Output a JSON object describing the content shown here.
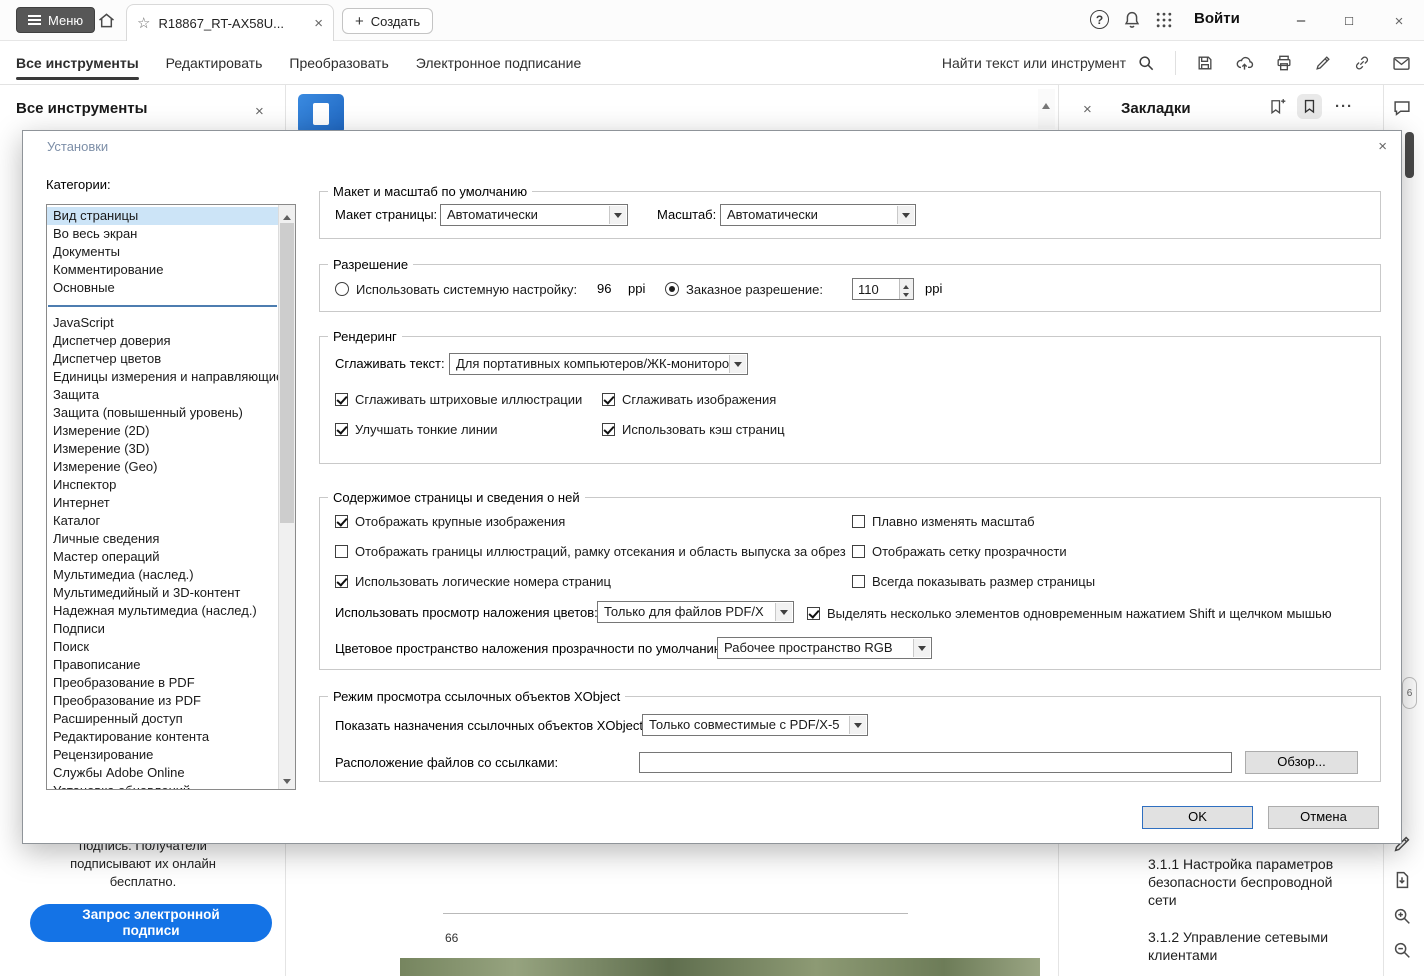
{
  "colors": {
    "accent_blue": "#1473e6",
    "selection_blue": "#cce4f7",
    "category_separator": "#4d7db0",
    "menu_button_bg": "#575757"
  },
  "topbar": {
    "menu_label": "Меню",
    "tab_title": "R18867_RT-AX58U...",
    "create_label": "Создать",
    "signin_label": "Войти"
  },
  "toolbar": {
    "tabs": [
      "Все инструменты",
      "Редактировать",
      "Преобразовать",
      "Электронное подписание"
    ],
    "active_tab": "Все инструменты",
    "search_label": "Найти текст или инструмент"
  },
  "left_panel": {
    "title": "Все инструменты",
    "esign_lines": [
      "подпись. Получатели",
      "подписывают их онлайн",
      "бесплатно."
    ],
    "esign_button": "Запрос электронной подписи"
  },
  "document": {
    "page_number": "66"
  },
  "bookmarks": {
    "title": "Закладки",
    "items": [
      "3.1.1 Настройка параметров безопасности беспроводной сети",
      "3.1.2 Управление сетевыми клиентами"
    ]
  },
  "right_rail": {
    "badge": "6"
  },
  "dialog": {
    "title": "Установки",
    "categories_label": "Категории:",
    "selected_category": "Вид страницы",
    "categories": [
      "Вид страницы",
      "Во весь экран",
      "Документы",
      "Комментирование",
      "Основные",
      "JavaScript",
      "Диспетчер доверия",
      "Диспетчер цветов",
      "Единицы измерения и направляющие",
      "Защита",
      "Защита (повышенный уровень)",
      "Измерение (2D)",
      "Измерение (3D)",
      "Измерение (Geo)",
      "Инспектор",
      "Интернет",
      "Каталог",
      "Личные сведения",
      "Мастер операций",
      "Мультимедиа (наслед.)",
      "Мультимедийный и 3D-контент",
      "Надежная мультимедиа (наслед.)",
      "Подписи",
      "Поиск",
      "Правописание",
      "Преобразование в PDF",
      "Преобразование из PDF",
      "Расширенный доступ",
      "Редактирование контента",
      "Рецензирование",
      "Службы Adobe Online",
      "Установка обновлений"
    ],
    "layout_section": {
      "title": "Макет и масштаб по умолчанию",
      "page_layout_label": "Макет страницы:",
      "page_layout_value": "Автоматически",
      "zoom_label": "Масштаб:",
      "zoom_value": "Автоматически"
    },
    "resolution_section": {
      "title": "Разрешение",
      "use_system_label": "Использовать системную настройку:",
      "system_selected": false,
      "system_value": "96",
      "system_unit": "ppi",
      "custom_label": "Заказное разрешение:",
      "custom_selected": true,
      "custom_value": "110",
      "custom_unit": "ppi"
    },
    "rendering_section": {
      "title": "Рендеринг",
      "smooth_text_label": "Сглаживать текст:",
      "smooth_text_value": "Для портативных компьютеров/ЖК-мониторов",
      "cb_smooth_line_art": {
        "label": "Сглаживать штриховые иллюстрации",
        "checked": true
      },
      "cb_smooth_images": {
        "label": "Сглаживать изображения",
        "checked": true
      },
      "cb_enhance_lines": {
        "label": "Улучшать тонкие линии",
        "checked": true
      },
      "cb_page_cache": {
        "label": "Использовать кэш страниц",
        "checked": true
      }
    },
    "content_section": {
      "title": "Содержимое страницы и сведения о ней",
      "cb_large_images": {
        "label": "Отображать крупные изображения",
        "checked": true
      },
      "cb_smooth_zoom": {
        "label": "Плавно изменять масштаб",
        "checked": false
      },
      "cb_art_box": {
        "label": "Отображать границы иллюстраций, рамку отсекания и область выпуска за обрез",
        "checked": false
      },
      "cb_transparency_grid": {
        "label": "Отображать сетку прозрачности",
        "checked": false
      },
      "cb_logical_pages": {
        "label": "Использовать логические номера страниц",
        "checked": true
      },
      "cb_page_size": {
        "label": "Всегда показывать размер страницы",
        "checked": false
      },
      "overprint_label": "Использовать просмотр наложения цветов:",
      "overprint_value": "Только для файлов PDF/X",
      "cb_shift_select": {
        "label": "Выделять несколько элементов одновременным нажатием Shift и щелчком мышью",
        "checked": true
      },
      "blend_label": "Цветовое пространство наложения прозрачности по умолчанию:",
      "blend_value": "Рабочее пространство RGB"
    },
    "xobject_section": {
      "title": "Режим просмотра ссылочных объектов XObject",
      "targets_label": "Показать назначения ссылочных объектов XObject:",
      "targets_value": "Только совместимые с PDF/X-5",
      "location_label": "Расположение файлов со ссылками:",
      "location_value": "",
      "browse_label": "Обзор..."
    },
    "ok_label": "OK",
    "cancel_label": "Отмена"
  }
}
